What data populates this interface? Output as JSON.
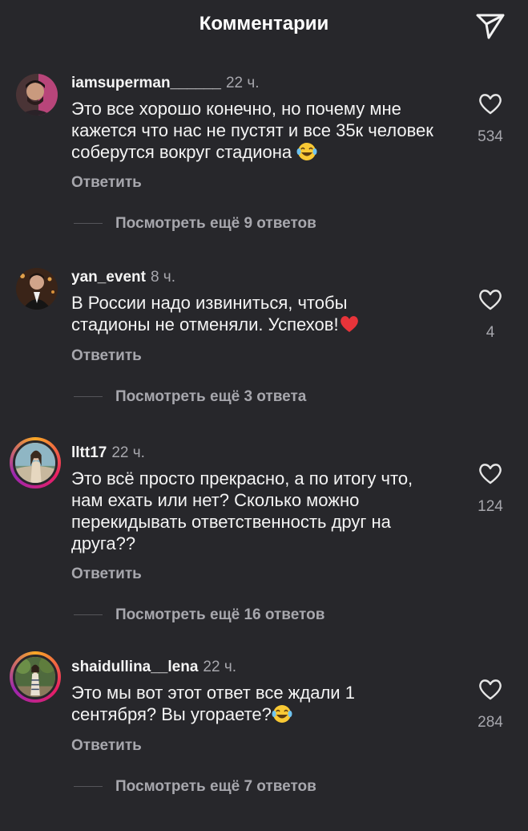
{
  "header": {
    "title": "Комментарии"
  },
  "comments": [
    {
      "username": "iamsuperman______",
      "time": "22 ч.",
      "text": "Это все хорошо конечно, но почему мне кажется что нас не пустят и все 35к человек соберутся вокруг стадиона",
      "emoji": "laughing-emoji",
      "reply_label": "Ответить",
      "likes": "534",
      "more_replies": "Посмотреть ещё 9 ответов"
    },
    {
      "username": "yan_event",
      "time": "8 ч.",
      "text": "В России надо извиниться, чтобы стадионы не отменяли. Успехов!",
      "emoji": "heart-emoji",
      "reply_label": "Ответить",
      "likes": "4",
      "more_replies": "Посмотреть ещё 3 ответа"
    },
    {
      "username": "lltt17",
      "time": "22 ч.",
      "text": "Это всё просто прекрасно, а по итогу что, нам ехать или нет? Сколько можно перекидывать ответственность друг на друга??",
      "emoji": "",
      "reply_label": "Ответить",
      "likes": "124",
      "more_replies": "Посмотреть ещё 16 ответов"
    },
    {
      "username": "shaidullina__lena",
      "time": "22 ч.",
      "text": "Это мы вот этот ответ все ждали 1 сентября? Вы угораете?",
      "emoji": "laughing-emoji",
      "reply_label": "Ответить",
      "likes": "284",
      "more_replies": "Посмотреть ещё 7 ответов"
    }
  ],
  "colors": {
    "background": "#27272b",
    "text_primary": "#f4f4f4",
    "text_secondary": "#a7a7ad",
    "story_ring_start": "#f9a825",
    "story_ring_end": "#9c27b0"
  },
  "icons": {
    "share": "paper-plane-icon",
    "like": "heart-outline-icon"
  }
}
